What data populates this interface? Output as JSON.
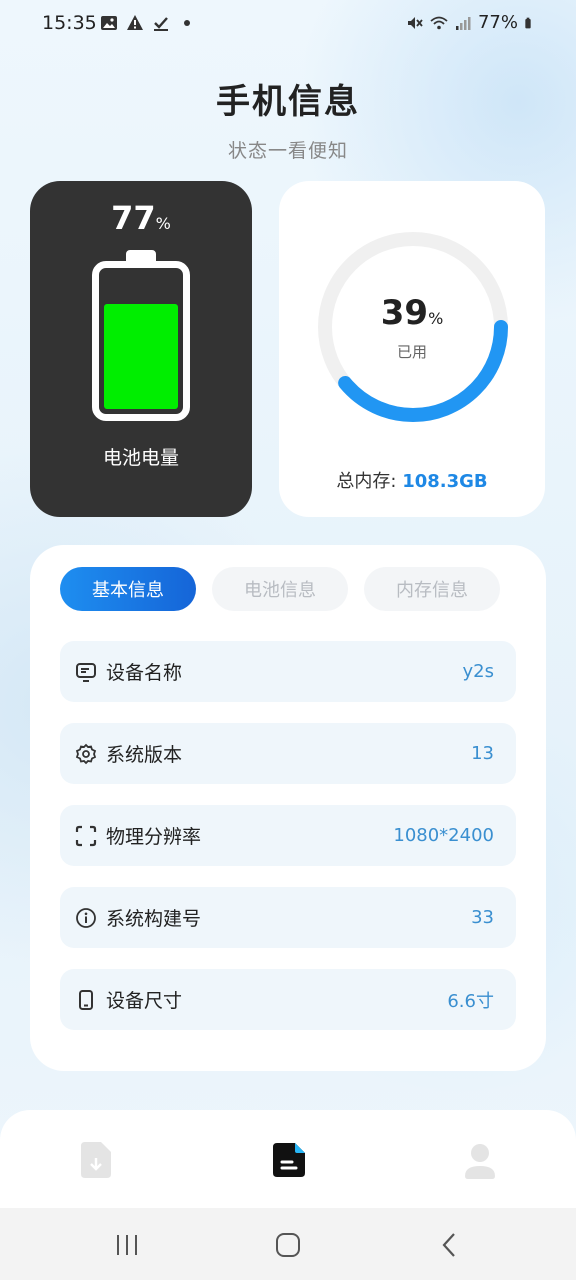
{
  "status_bar": {
    "time": "15:35",
    "battery_pct": "77%"
  },
  "header": {
    "title": "手机信息",
    "subtitle": "状态一看便知"
  },
  "battery": {
    "value": "77",
    "unit": "%",
    "level": 0.77,
    "label": "电池电量",
    "fill_color": "#00ee00"
  },
  "memory": {
    "value": "39",
    "unit": "%",
    "used_fraction": 0.39,
    "used_label": "已用",
    "total_label": "总内存:",
    "total_value": "108.3GB",
    "ring_color": "#2196f3",
    "track_color": "#f0f0f0"
  },
  "tabs": [
    {
      "label": "基本信息",
      "active": true
    },
    {
      "label": "电池信息",
      "active": false
    },
    {
      "label": "内存信息",
      "active": false
    }
  ],
  "rows": [
    {
      "icon": "monitor-icon",
      "label": "设备名称",
      "value": "y2s"
    },
    {
      "icon": "gear-icon",
      "label": "系统版本",
      "value": "13"
    },
    {
      "icon": "scan-frame-icon",
      "label": "物理分辨率",
      "value": "1080*2400"
    },
    {
      "icon": "info-icon",
      "label": "系统构建号",
      "value": "33"
    },
    {
      "icon": "phone-icon",
      "label": "设备尺寸",
      "value": "6.6寸"
    }
  ],
  "bottom_nav": [
    {
      "icon": "download-file-icon",
      "active": false
    },
    {
      "icon": "document-icon",
      "active": true
    },
    {
      "icon": "user-icon",
      "active": false
    }
  ],
  "colors": {
    "accent": "#1e88e5",
    "value_blue": "#3a8fd0",
    "battery_card_bg": "#333333"
  }
}
